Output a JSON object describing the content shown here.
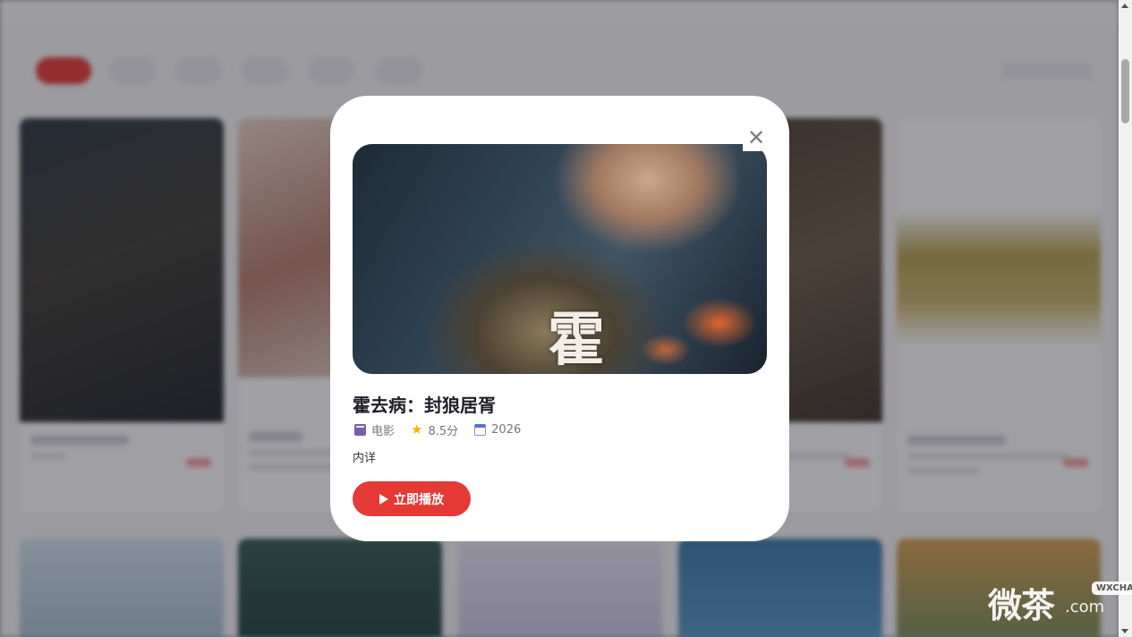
{
  "modal": {
    "title": "霍去病：封狼居胥",
    "category": "电影",
    "rating": "8.5分",
    "year": "2026",
    "description": "内详",
    "play_label": "立即播放",
    "close_symbol": "✕",
    "hero_glyph": "霍",
    "icons": {
      "category": "film-icon",
      "rating": "star-icon",
      "year": "calendar-icon",
      "play": "play-icon",
      "close": "close-icon"
    }
  },
  "watermark": {
    "main": "微茶",
    "badge": "WXCHA",
    "suffix": ".com"
  },
  "colors": {
    "accent": "#e53935",
    "star": "#f4b400",
    "overlay": "rgba(30,30,40,0.42)"
  }
}
